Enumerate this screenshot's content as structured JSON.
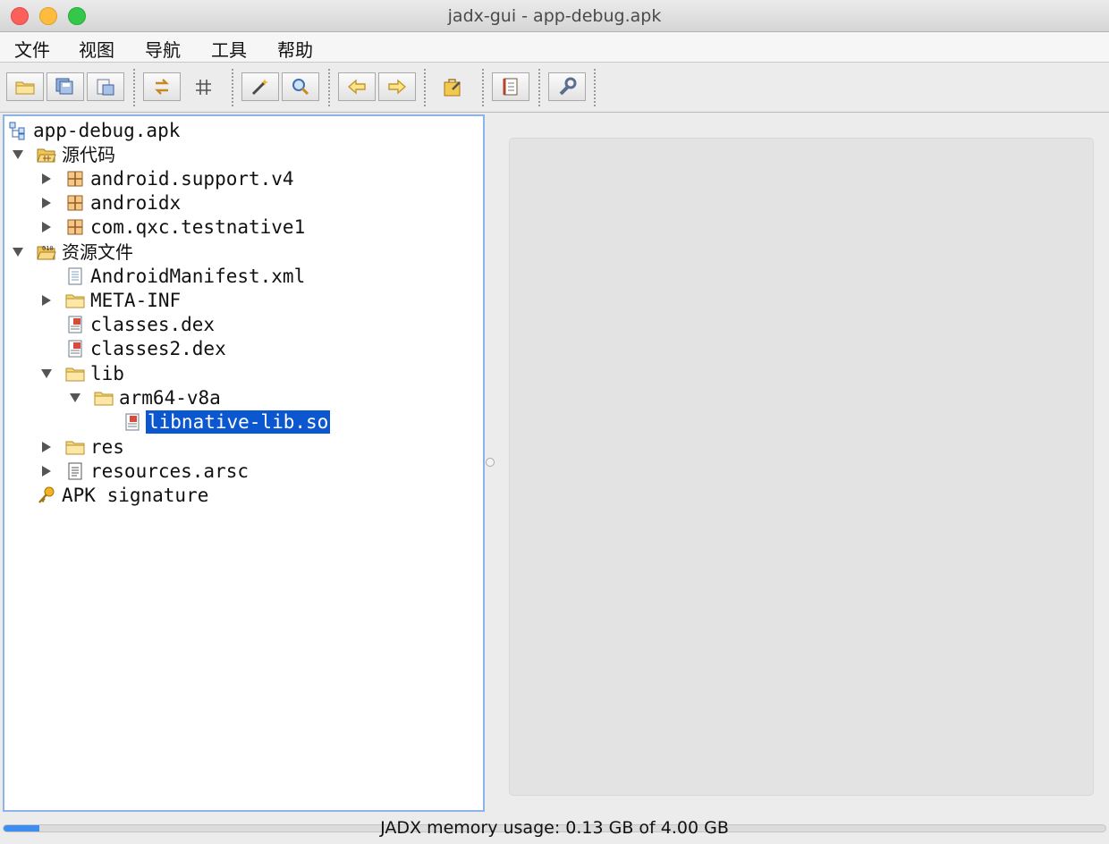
{
  "window": {
    "title": "jadx-gui - app-debug.apk"
  },
  "menu": [
    {
      "label": "文件"
    },
    {
      "label": "视图"
    },
    {
      "label": "导航"
    },
    {
      "label": "工具"
    },
    {
      "label": "帮助"
    }
  ],
  "toolbar": {
    "buttons": [
      {
        "icon": "open-folder-icon"
      },
      {
        "icon": "save-all-icon"
      },
      {
        "icon": "export-icon"
      },
      {
        "icon": "sync-icon"
      },
      {
        "icon": "flatten-packages-icon"
      },
      {
        "icon": "magic-wand-icon"
      },
      {
        "icon": "search-icon"
      },
      {
        "icon": "back-arrow-icon"
      },
      {
        "icon": "forward-arrow-icon"
      },
      {
        "icon": "deobfuscation-icon"
      },
      {
        "icon": "log-viewer-icon"
      },
      {
        "icon": "preferences-wrench-icon"
      }
    ]
  },
  "tree": {
    "root": "app-debug.apk",
    "source_code": "源代码",
    "pkg_support_v4": "android.support.v4",
    "pkg_androidx": "androidx",
    "pkg_qxc": "com.qxc.testnative1",
    "resources": "资源文件",
    "manifest": "AndroidManifest.xml",
    "meta_inf": "META-INF",
    "classes_dex": "classes.dex",
    "classes2_dex": "classes2.dex",
    "lib": "lib",
    "arm64": "arm64-v8a",
    "so_file": "libnative-lib.so",
    "res": "res",
    "resources_arsc": "resources.arsc",
    "apk_signature": "APK signature"
  },
  "status": {
    "memory_text": "JADX memory usage: 0.13 GB of 4.00 GB",
    "memory_fraction": 0.0325
  },
  "colors": {
    "selection": "#0b57d0",
    "tree_border": "#8db4e8",
    "progress_fill": "#3d8ef0"
  }
}
